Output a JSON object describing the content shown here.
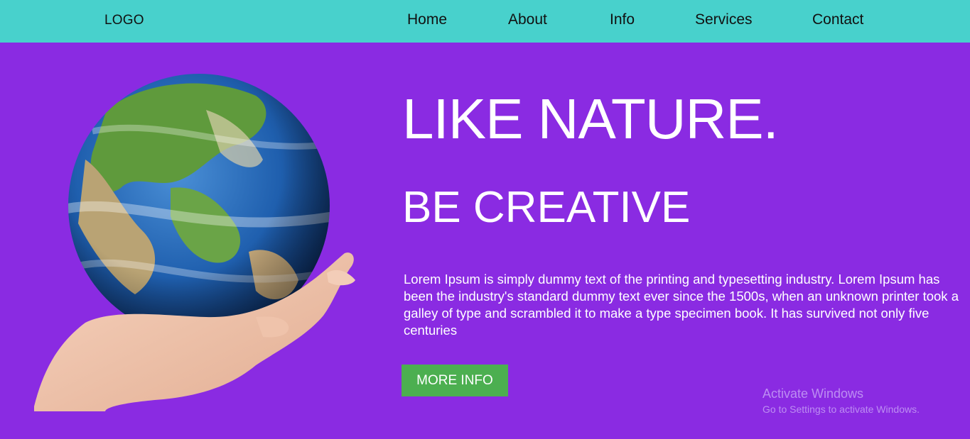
{
  "navbar": {
    "logo": "LOGO",
    "links": [
      "Home",
      "About",
      "Info",
      "Services",
      "Contact"
    ]
  },
  "hero": {
    "headline": "LIKE NATURE.",
    "subheadline": "BE CREATIVE",
    "body": "Lorem Ipsum is simply dummy text of the printing and typesetting industry. Lorem Ipsum has been the industry's standard dummy text ever since the 1500s, when an unknown printer took a galley of type and scrambled it to make a type specimen book. It has survived not only five centuries",
    "button_label": "MORE INFO"
  },
  "watermark": {
    "title": "Activate Windows",
    "subtitle": "Go to Settings to activate Windows."
  },
  "colors": {
    "navbar_bg": "#48d1cc",
    "page_bg": "#8a2be2",
    "button_bg": "#4caf50"
  }
}
